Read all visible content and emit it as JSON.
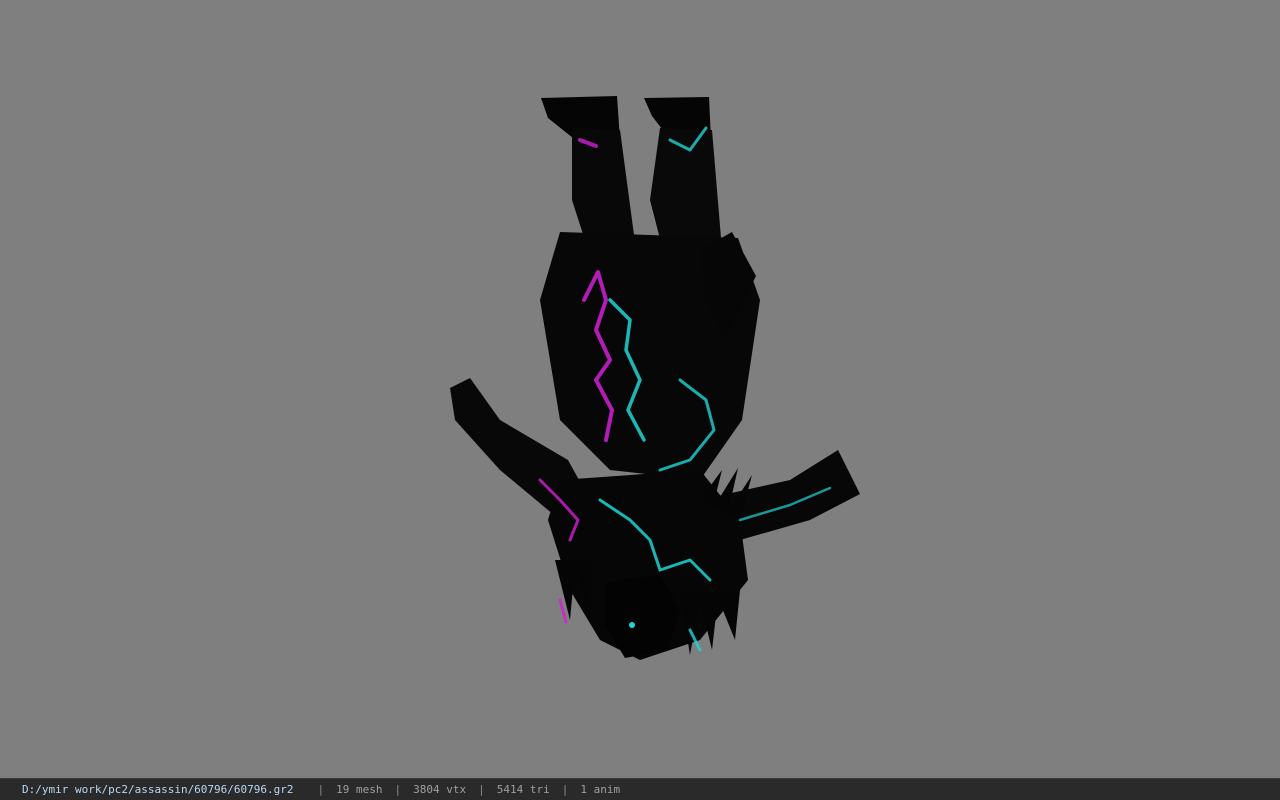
{
  "viewport": {
    "background": "#7f7f7f",
    "model": {
      "body_color": "#0a0a0a",
      "glow_cyan": "#1fd6d6",
      "glow_magenta": "#d21fd6"
    }
  },
  "statusbar": {
    "file_path": "D:/ymir work/pc2/assassin/60796/60796.gr2",
    "separator": "|",
    "mesh": "19 mesh",
    "vtx": "3804 vtx",
    "tri": "5414 tri",
    "anim": "1 anim"
  }
}
